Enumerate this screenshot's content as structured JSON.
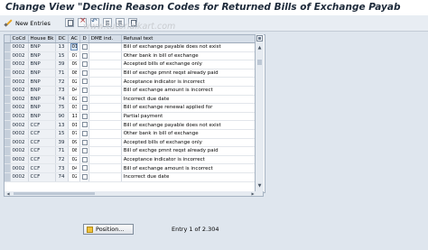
{
  "window": {
    "title": "Change View \"Decline Reason Codes for Returned Bills of Exchange Payab"
  },
  "watermark": "www.tutorialkart.com",
  "toolbar": {
    "new_entries_label": "New Entries"
  },
  "table": {
    "columns": [
      "CoCd",
      "House Bk",
      "DC",
      "AC",
      "D",
      "DME ind.",
      "Refusal text"
    ],
    "rows": [
      {
        "cocd": "0002",
        "house_bk": "BNP",
        "dc": "13",
        "ac": "01",
        "d": "",
        "dme": "",
        "text": "Bill of exchange payable does not exist"
      },
      {
        "cocd": "0002",
        "house_bk": "BNP",
        "dc": "15",
        "ac": "07",
        "d": "",
        "dme": "",
        "text": "Other bank in bill of exchange"
      },
      {
        "cocd": "0002",
        "house_bk": "BNP",
        "dc": "39",
        "ac": "09",
        "d": "",
        "dme": "",
        "text": "Accepted bills of exchange only"
      },
      {
        "cocd": "0002",
        "house_bk": "BNP",
        "dc": "71",
        "ac": "08",
        "d": "",
        "dme": "",
        "text": "Bill of exchge pmnt reqst already paid"
      },
      {
        "cocd": "0002",
        "house_bk": "BNP",
        "dc": "72",
        "ac": "02",
        "d": "",
        "dme": "",
        "text": "Acceptance indicator is incorrect"
      },
      {
        "cocd": "0002",
        "house_bk": "BNP",
        "dc": "73",
        "ac": "04",
        "d": "",
        "dme": "",
        "text": "Bill of exchange amount is incorrect"
      },
      {
        "cocd": "0002",
        "house_bk": "BNP",
        "dc": "74",
        "ac": "02",
        "d": "",
        "dme": "",
        "text": "Incorrect due date"
      },
      {
        "cocd": "0002",
        "house_bk": "BNP",
        "dc": "75",
        "ac": "03",
        "d": "",
        "dme": "",
        "text": "Bill of exchange renewal applied for"
      },
      {
        "cocd": "0002",
        "house_bk": "BNP",
        "dc": "90",
        "ac": "11",
        "d": "",
        "dme": "",
        "text": "Partial payment"
      },
      {
        "cocd": "0002",
        "house_bk": "CCF",
        "dc": "13",
        "ac": "01",
        "d": "",
        "dme": "",
        "text": "Bill of exchange payable does not exist"
      },
      {
        "cocd": "0002",
        "house_bk": "CCF",
        "dc": "15",
        "ac": "07",
        "d": "",
        "dme": "",
        "text": "Other bank in bill of exchange"
      },
      {
        "cocd": "0002",
        "house_bk": "CCF",
        "dc": "39",
        "ac": "09",
        "d": "",
        "dme": "",
        "text": "Accepted bills of exchange only"
      },
      {
        "cocd": "0002",
        "house_bk": "CCF",
        "dc": "71",
        "ac": "08",
        "d": "",
        "dme": "",
        "text": "Bill of exchge pmnt reqst already paid"
      },
      {
        "cocd": "0002",
        "house_bk": "CCF",
        "dc": "72",
        "ac": "02",
        "d": "",
        "dme": "",
        "text": "Acceptance indicator is incorrect"
      },
      {
        "cocd": "0002",
        "house_bk": "CCF",
        "dc": "73",
        "ac": "04",
        "d": "",
        "dme": "",
        "text": "Bill of exchange amount is incorrect"
      },
      {
        "cocd": "0002",
        "house_bk": "CCF",
        "dc": "74",
        "ac": "02",
        "d": "",
        "dme": "",
        "text": "Incorrect due date"
      }
    ]
  },
  "footer": {
    "position_button_label": "Position...",
    "entry_info": "Entry 1 of 2.304"
  }
}
